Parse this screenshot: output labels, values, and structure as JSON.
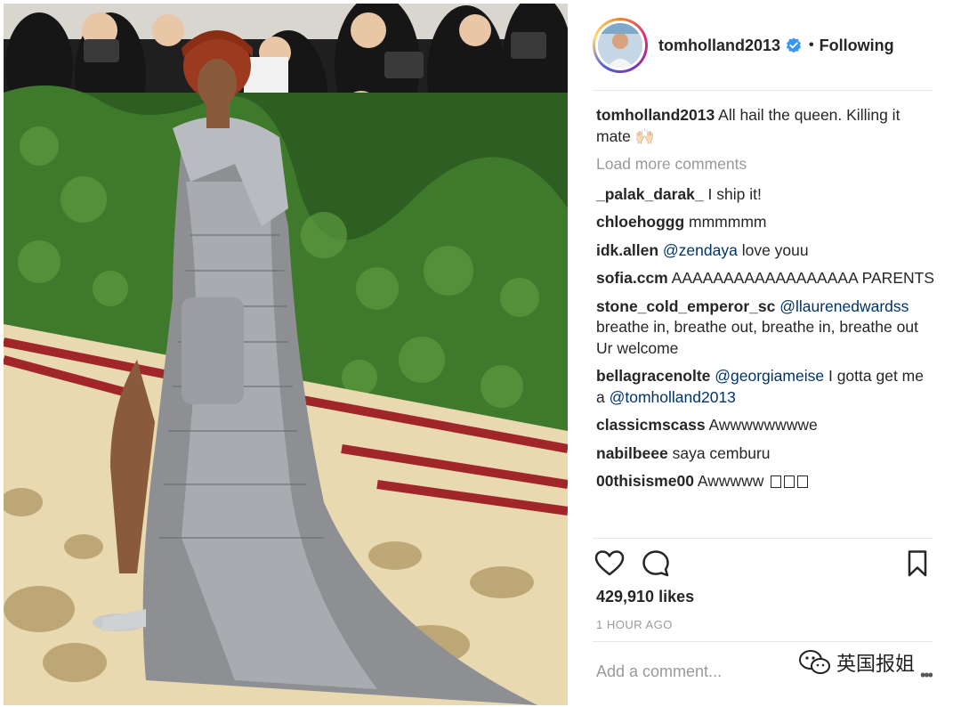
{
  "post": {
    "username": "tomholland2013",
    "follow_state": "Following",
    "dot": "•",
    "caption_user": "tomholland2013",
    "caption_text": "All hail the queen. Killing it mate",
    "caption_emoji": "🙌🏻",
    "load_more": "Load more comments",
    "likes": "429,910 likes",
    "time": "1 HOUR AGO",
    "add_comment_placeholder": "Add a comment...",
    "more_icon": "•••"
  },
  "comments": [
    {
      "user": "_palak_darak_",
      "text": "I ship it!"
    },
    {
      "user": "chloehoggg",
      "text": "mmmmmm"
    },
    {
      "user": "idk.allen",
      "mention": "@zendaya",
      "text": "love youu"
    },
    {
      "user": "sofia.ccm",
      "text": "AAAAAAAAAAAAAAAAAA PARENTS"
    },
    {
      "user": "stone_cold_emperor_sc",
      "mention": "@llaurenedwardss",
      "text": "breathe in, breathe out, breathe in, breathe out",
      "text2": "Ur welcome"
    },
    {
      "user": "bellagracenolte",
      "mention": "@georgiameise",
      "text": "I gotta get me a",
      "mention2": "@tomholland2013"
    },
    {
      "user": "classicmscass",
      "text": "Awwwwwwwwe"
    },
    {
      "user": "nabilbeee",
      "text": "saya cemburu"
    },
    {
      "user": "00thisisme00",
      "text": "Awwwww"
    }
  ],
  "watermark": {
    "text": "英国报姐"
  },
  "icons": {
    "like": "heart-icon",
    "comment": "comment-bubble-icon",
    "save": "bookmark-icon",
    "verified": "verified-badge-icon"
  },
  "colors": {
    "mention": "#003569",
    "muted": "#999999",
    "verified": "#3897f0"
  }
}
